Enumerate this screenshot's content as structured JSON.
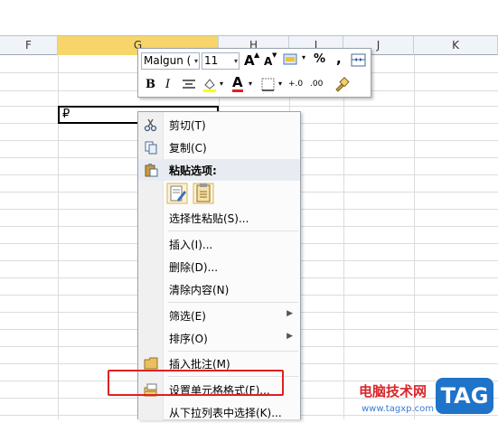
{
  "columns": [
    {
      "label": "F",
      "selected": false
    },
    {
      "label": "G",
      "selected": true
    },
    {
      "label": "H",
      "selected": false
    },
    {
      "label": "I",
      "selected": false
    },
    {
      "label": "J",
      "selected": false
    },
    {
      "label": "K",
      "selected": false
    }
  ],
  "active_cell": {
    "value": "₽"
  },
  "mini_toolbar": {
    "font_name": "Malgun (",
    "font_size": "11",
    "grow_font": "A",
    "shrink_font": "A",
    "percent": "%",
    "comma": ",",
    "bold": "B",
    "italic": "I",
    "font_color": "A",
    "increase_decimal": "+.0",
    "decrease_decimal": ".00"
  },
  "context_menu": {
    "items": [
      {
        "label": "剪切(T)",
        "icon": "scissors-icon"
      },
      {
        "label": "复制(C)",
        "icon": "copy-icon"
      },
      {
        "label": "粘贴选项:",
        "icon": "paste-icon"
      },
      {
        "label": "选择性粘贴(S)..."
      },
      {
        "label": "插入(I)..."
      },
      {
        "label": "删除(D)..."
      },
      {
        "label": "清除内容(N)"
      },
      {
        "label": "筛选(E)",
        "submenu": true
      },
      {
        "label": "排序(O)",
        "submenu": true
      },
      {
        "label": "插入批注(M)",
        "icon": "comment-icon"
      },
      {
        "label": "设置单元格格式(F)...",
        "icon": "format-cells-icon"
      },
      {
        "label": "从下拉列表中选择(K)..."
      }
    ]
  },
  "watermark": {
    "title": "电脑技术网",
    "url": "www.tagxp.com",
    "tag": "TAG"
  },
  "colors": {
    "selected_column": "#f7d56b",
    "highlight_border": "#e02020",
    "watermark_red": "#d8262b",
    "watermark_blue": "#1f73c9"
  }
}
